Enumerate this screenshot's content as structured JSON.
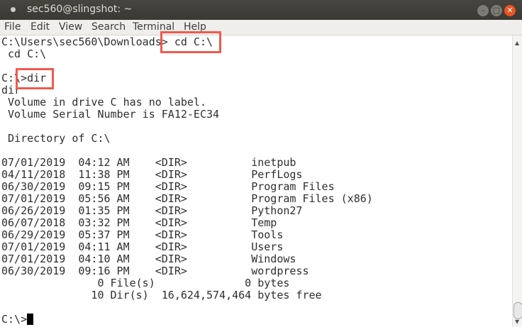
{
  "window": {
    "title": "sec560@slingshot: ~"
  },
  "menu": [
    "File",
    "Edit",
    "View",
    "Search",
    "Terminal",
    "Help"
  ],
  "terminal": {
    "lines": [
      "C:\\Users\\sec560\\Downloads> cd C:\\",
      " cd C:\\",
      "",
      "C:\\>dir",
      "dir",
      " Volume in drive C has no label.",
      " Volume Serial Number is FA12-EC34",
      "",
      " Directory of C:\\",
      "",
      "07/01/2019  04:12 AM    <DIR>          inetpub",
      "04/11/2018  11:38 PM    <DIR>          PerfLogs",
      "06/30/2019  09:15 PM    <DIR>          Program Files",
      "07/01/2019  05:56 AM    <DIR>          Program Files (x86)",
      "06/26/2019  01:35 PM    <DIR>          Python27",
      "06/07/2018  03:32 PM    <DIR>          Temp",
      "06/29/2019  05:37 PM    <DIR>          Tools",
      "07/01/2019  04:11 AM    <DIR>          Users",
      "07/01/2019  04:10 AM    <DIR>          Windows",
      "06/30/2019  09:16 PM    <DIR>          wordpress",
      "               0 File(s)              0 bytes",
      "              10 Dir(s)  16,624,574,464 bytes free",
      ""
    ],
    "prompt": "C:\\>"
  },
  "highlight_color": "#f05a4f"
}
